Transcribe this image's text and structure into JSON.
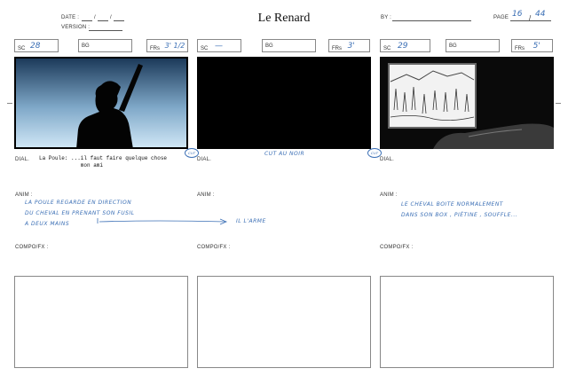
{
  "header": {
    "title": "Le Renard",
    "date_label": "DATE :",
    "version_label": "VERSION :",
    "by_label": "BY :",
    "page_label": "PAGE",
    "page_current": "16",
    "page_total": "44"
  },
  "labels": {
    "sc": "SC",
    "bg": "BG",
    "frs": "FRs",
    "dial": "DIAL.",
    "anim": "ANIM :",
    "compo": "COMPO/FX :"
  },
  "panels": [
    {
      "sc": "28",
      "frs": "3' 1/2",
      "dialogue": "La Poule: ...il faut faire quelque chose\n             mon ami",
      "anim_note": "LA POULE REGARDE EN DIRECTION\nDU CHEVAL EN PRENANT SON FUSIL\nA DEUX MAINS",
      "anim_arrow_note": "IL L'ARME",
      "stamp": "CUT"
    },
    {
      "sc": "—",
      "frs": "3'",
      "dial_note": "CUT AU NOIR",
      "stamp": "CUT"
    },
    {
      "sc": "29",
      "frs": "5'",
      "anim_note": "LE CHEVAL BOITE NORMALEMENT\nDANS SON BOX , PIÉTINE , SOUFFLE..."
    }
  ],
  "colors": {
    "ink": "#3b6fb5",
    "frame": "#000000",
    "sky_top": "#1c3a5a",
    "sky_bottom": "#cfe6f5"
  }
}
